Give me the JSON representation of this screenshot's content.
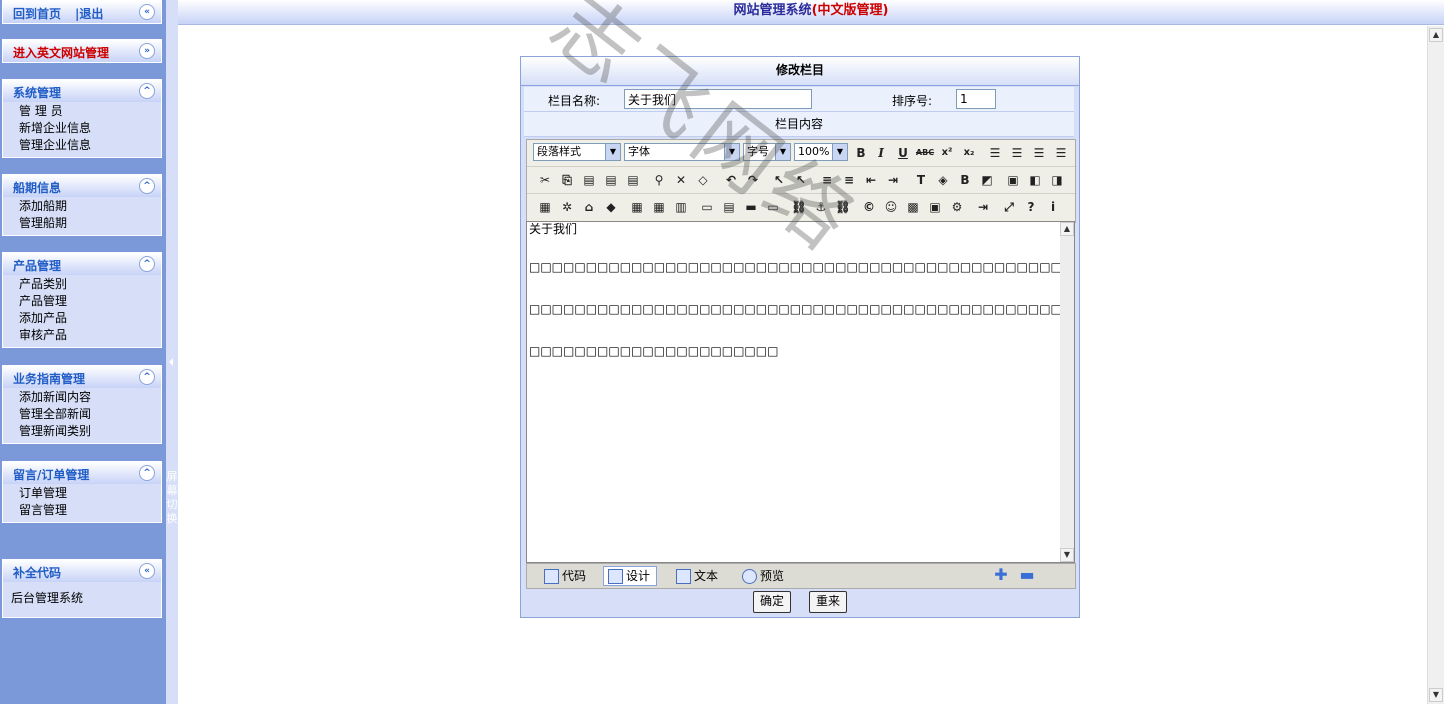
{
  "sidebar": {
    "panels": [
      {
        "title": "回到首页",
        "extra": "|退出",
        "toggle": "«",
        "items": []
      },
      {
        "title": "进入英文网站管理",
        "toggle": "»",
        "items": []
      },
      {
        "title": "系统管理",
        "toggle": "^",
        "items": [
          "管 理 员",
          "新增企业信息",
          "管理企业信息"
        ]
      },
      {
        "title": "船期信息",
        "toggle": "^",
        "items": [
          "添加船期",
          "管理船期"
        ]
      },
      {
        "title": "产品管理",
        "toggle": "^",
        "items": [
          "产品类别",
          "产品管理",
          "添加产品",
          "审核产品"
        ]
      },
      {
        "title": "业务指南管理",
        "toggle": "^",
        "items": [
          "添加新闻内容",
          "管理全部新闻",
          "管理新闻类别"
        ]
      },
      {
        "title": "留言/订单管理",
        "toggle": "^",
        "items": [
          "订单管理",
          "留言管理"
        ]
      },
      {
        "title": "补全代码",
        "toggle": "«",
        "items": [
          "后台管理系统"
        ]
      }
    ],
    "splitter_text": "屏幕切换"
  },
  "header": {
    "title": "网站管理系统",
    "subtitle": "(中文版管理)"
  },
  "form": {
    "title": "修改栏目",
    "name_label": "栏目名称:",
    "name_value": "关于我们",
    "order_label": "排序号:",
    "order_value": "1",
    "content_label": "栏目内容"
  },
  "editor": {
    "paragraph_select": "段落样式",
    "font_select": "字体",
    "size_select": "字号",
    "zoom_select": "100%",
    "content_lines": [
      "关于我们",
      "",
      "□□□□□□□□□□□□□□□□□□□□□□□□□□□□□□□□□□□□□□□□□□□□□□□□□",
      "",
      "□□□□□□□□□□□□□□□□□□□□□□□□□□□□□□□□□□□□□□□□□□□□□□□□□",
      "",
      "□□□□□□□□□□□□□□□□□□□□□□"
    ],
    "modes": [
      "代码",
      "设计",
      "文本",
      "预览"
    ]
  },
  "actions": {
    "confirm": "确定",
    "reset": "重来"
  },
  "watermark": "志飞网络"
}
